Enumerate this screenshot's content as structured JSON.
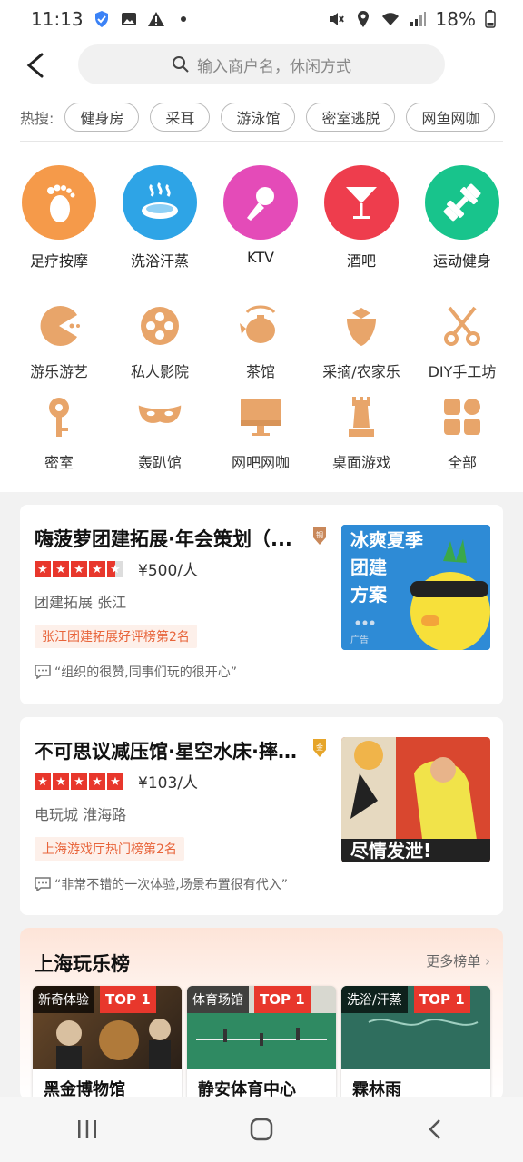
{
  "status": {
    "time": "11:13",
    "battery": "18%"
  },
  "search": {
    "placeholder": "输入商户名，休闲方式"
  },
  "hot": {
    "label": "热搜:",
    "chips": [
      "健身房",
      "采耳",
      "游泳馆",
      "密室逃脱",
      "网鱼网咖"
    ]
  },
  "big_categories": [
    {
      "label": "足疗按摩",
      "color": "#f59a4a",
      "icon": "foot-icon"
    },
    {
      "label": "洗浴汗蒸",
      "color": "#2ea4e6",
      "icon": "bath-icon"
    },
    {
      "label": "KTV",
      "color": "#e44bb8",
      "icon": "microphone-icon"
    },
    {
      "label": "酒吧",
      "color": "#ee3d4d",
      "icon": "cocktail-icon"
    },
    {
      "label": "运动健身",
      "color": "#18c48c",
      "icon": "dumbbell-icon"
    }
  ],
  "small_categories": [
    {
      "label": "游乐游艺",
      "icon": "pacman-icon"
    },
    {
      "label": "私人影院",
      "icon": "film-reel-icon"
    },
    {
      "label": "茶馆",
      "icon": "teapot-icon"
    },
    {
      "label": "采摘/农家乐",
      "icon": "strawberry-icon"
    },
    {
      "label": "DIY手工坊",
      "icon": "scissors-icon"
    },
    {
      "label": "密室",
      "icon": "key-icon"
    },
    {
      "label": "轰趴馆",
      "icon": "mask-icon"
    },
    {
      "label": "网吧网咖",
      "icon": "monitor-icon"
    },
    {
      "label": "桌面游戏",
      "icon": "chess-icon"
    },
    {
      "label": "全部",
      "icon": "grid-icon"
    }
  ],
  "cards": [
    {
      "title": "嗨菠萝团建拓展·年会策划（...",
      "rating": 4.5,
      "price": "¥500/人",
      "tags": "团建拓展 张江",
      "rank": "张江团建拓展好评榜第2名",
      "review": "“组织的很赞,同事们玩的很开心”",
      "medal": "铜",
      "thumb_text": [
        "冰爽夏季",
        "团建",
        "方案"
      ],
      "ad": "广告"
    },
    {
      "title": "不可思议减压馆·星空水床·摔...",
      "rating": 5,
      "price": "¥103/人",
      "tags": "电玩城 淮海路",
      "rank": "上海游戏厅热门榜第2名",
      "review": "“非常不错的一次体验,场景布置很有代入”",
      "medal": "金",
      "thumb_text": [
        "尽情发泄!"
      ]
    }
  ],
  "ranking": {
    "title": "上海玩乐榜",
    "more": "更多榜单",
    "items": [
      {
        "category": "新奇体验",
        "top": "TOP 1",
        "name": "黑金博物馆"
      },
      {
        "category": "体育场馆",
        "top": "TOP 1",
        "name": "静安体育中心"
      },
      {
        "category": "洗浴/汗蒸",
        "top": "TOP 1",
        "name": "霖林雨"
      }
    ]
  }
}
